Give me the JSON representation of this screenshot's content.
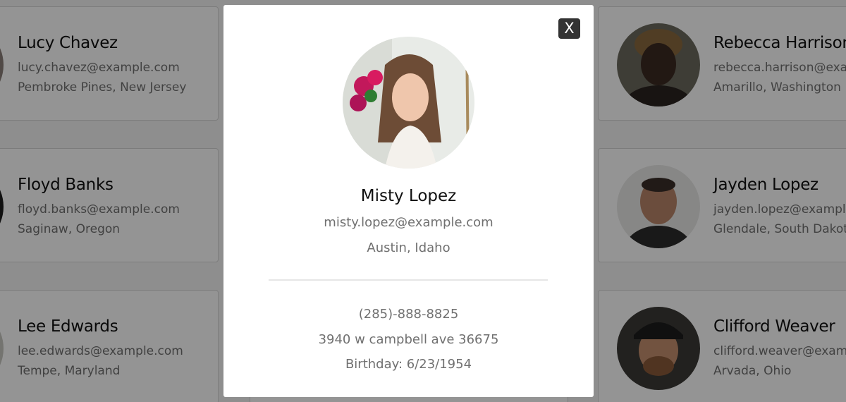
{
  "cards": [
    {
      "name": "Lucy Chavez",
      "email": "lucy.chavez@example.com",
      "location": "Pembroke Pines, New Jersey"
    },
    {
      "name": "Rebecca Harrison",
      "email": "rebecca.harrison@example.com",
      "location": "Amarillo, Washington"
    },
    {
      "name": "Floyd Banks",
      "email": "floyd.banks@example.com",
      "location": "Saginaw, Oregon"
    },
    {
      "name": "Jayden Lopez",
      "email": "jayden.lopez@example.com",
      "location": "Glendale, South Dakota"
    },
    {
      "name": "Lee Edwards",
      "email": "lee.edwards@example.com",
      "location": "Tempe, Maryland"
    },
    {
      "name": "Clifford Weaver",
      "email": "clifford.weaver@example.com",
      "location": "Arvada, Ohio"
    }
  ],
  "modal": {
    "close_label": "X",
    "name": "Misty Lopez",
    "email": "misty.lopez@example.com",
    "location": "Austin, Idaho",
    "phone": "(285)-888-8825",
    "address": "3940 w campbell ave 36675",
    "birthday": "Birthday: 6/23/1954"
  }
}
